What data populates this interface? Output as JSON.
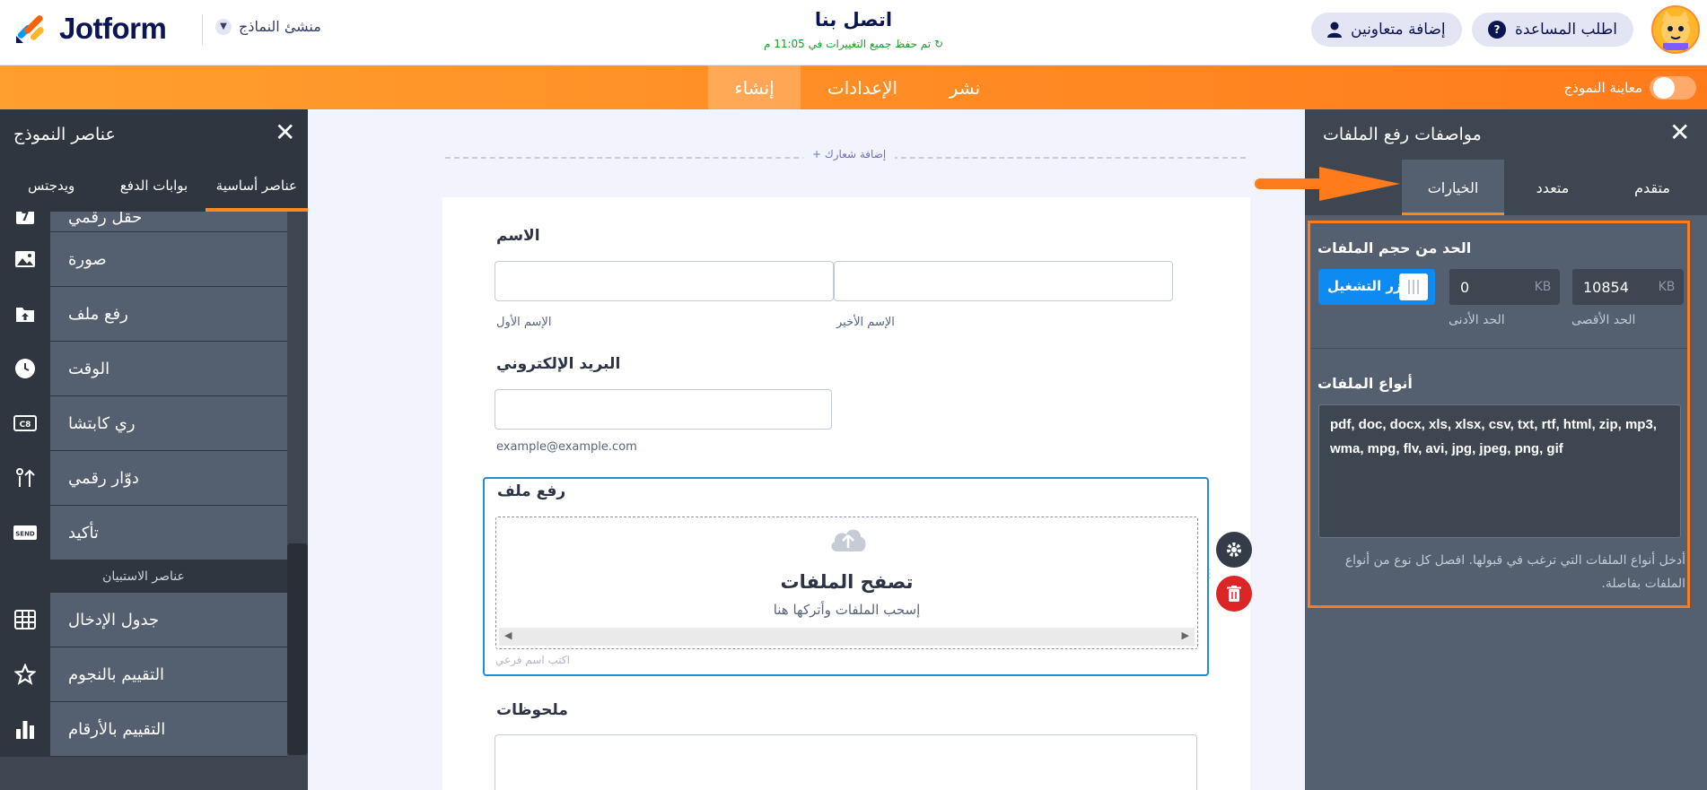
{
  "header": {
    "logo_text": "Jotform",
    "builder_label": "منشئ النماذج",
    "form_title": "اتصل بنا",
    "save_status": "تم حفظ جميع التغييرات في 11:05 م",
    "help_button": "اطلب المساعدة",
    "help_icon": "?",
    "collab_button": "إضافة متعاونين"
  },
  "nav": {
    "tabs": [
      "إنشاء",
      "الإعدادات",
      "نشر"
    ],
    "active": "إنشاء",
    "preview_label": "معاينة النموذج"
  },
  "left_panel": {
    "title": "عناصر النموذج",
    "tabs": [
      "ويدجتس",
      "بوابات الدفع",
      "عناصر أساسية"
    ],
    "items": [
      {
        "icon": "number-7-icon",
        "label": "حقل رقمي"
      },
      {
        "icon": "image-icon",
        "label": "صورة"
      },
      {
        "icon": "upload-icon",
        "label": "رفع ملف"
      },
      {
        "icon": "clock-icon",
        "label": "الوقت"
      },
      {
        "icon": "captcha-icon",
        "label": "ري كابتشا"
      },
      {
        "icon": "spinner-icon",
        "label": "دوّار رقمي"
      },
      {
        "icon": "send-icon",
        "label": "تأكيد"
      }
    ],
    "section_label": "عناصر الاستبيان",
    "survey_items": [
      {
        "icon": "grid-icon",
        "label": "جدول الإدخال"
      },
      {
        "icon": "star-icon",
        "label": "التقييم بالنجوم"
      },
      {
        "icon": "bar-chart-icon",
        "label": "التقييم بالأرقام"
      }
    ]
  },
  "canvas": {
    "add_logo": "+ إضافة شعارك",
    "name_label": "الاسم",
    "first_name_sub": "الإسم الأول",
    "last_name_sub": "الإسم الأخير",
    "email_label": "البريد الإلكتروني",
    "email_sub": "example@example.com",
    "upload_label": "رفع ملف",
    "upload_title": "تصفح الملفات",
    "upload_sub": "إسحب الملفات وأتركها هنا",
    "upload_hint": "اكتب اسم فرعي",
    "notes_label": "ملحوظات"
  },
  "right_panel": {
    "title": "مواصفات رفع الملفات",
    "tabs": [
      "متقدم",
      "متعدد",
      "الخيارات"
    ],
    "active_tab": "الخيارات",
    "size_limit_title": "الحد من حجم الملفات",
    "toggle_label": "زر التشغيل",
    "min_unit": "KB",
    "min_value": "0",
    "min_label": "الحد الأدنى",
    "max_unit": "KB",
    "max_value": "10854",
    "max_label": "الحد الأقصى",
    "file_types_title": "أنواع الملفات",
    "file_types_value": "pdf, doc, docx, xls, xlsx, csv, txt, rtf, html, zip, mp3, wma, mpg, flv, avi, jpg, jpeg, png, gif",
    "file_types_hint": "أدخل أنواع الملفات التي ترغب في قبولها. افصل كل نوع من أنواع الملفات بفاصلة."
  },
  "colors": {
    "accent_orange": "#ff7b1c",
    "toggle_blue": "#0d8bf2",
    "delete_red": "#dc2626",
    "save_green": "#1a9c2c"
  }
}
